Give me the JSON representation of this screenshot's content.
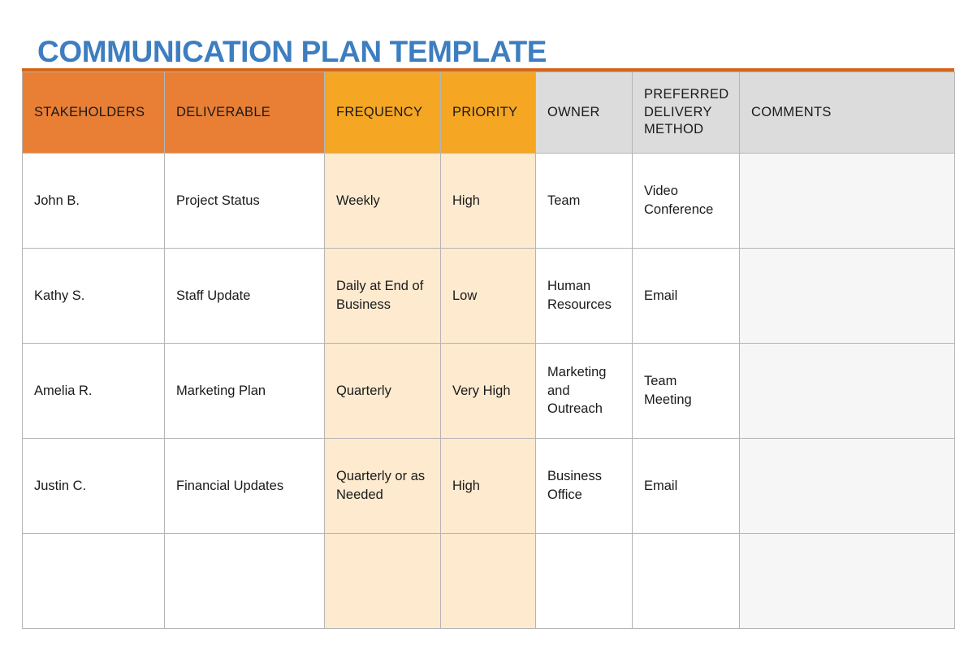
{
  "document": {
    "title": "COMMUNICATION PLAN TEMPLATE",
    "title_color": "#3d7ec0"
  },
  "theme": {
    "top_border": "#d4651a",
    "header_orange": "#e87f35",
    "header_amber": "#f5a623",
    "header_gray": "#dcdcdc",
    "cell_peach": "#fdeacf",
    "cell_gray": "#f6f6f6",
    "grid_line": "#b5b5b5",
    "text": "#1a1a1a"
  },
  "table": {
    "columns": [
      {
        "key": "stakeholders",
        "label": "STAKEHOLDERS",
        "header_style": "orange",
        "cell_style": "plain"
      },
      {
        "key": "deliverable",
        "label": "DELIVERABLE",
        "header_style": "orange",
        "cell_style": "plain"
      },
      {
        "key": "frequency",
        "label": "FREQUENCY",
        "header_style": "amber",
        "cell_style": "peach"
      },
      {
        "key": "priority",
        "label": "PRIORITY",
        "header_style": "amber",
        "cell_style": "peach"
      },
      {
        "key": "owner",
        "label": "OWNER",
        "header_style": "gray",
        "cell_style": "plain"
      },
      {
        "key": "delivery_method",
        "label": "PREFERRED DELIVERY METHOD",
        "header_style": "gray",
        "cell_style": "plain"
      },
      {
        "key": "comments",
        "label": "COMMENTS",
        "header_style": "gray",
        "cell_style": "gray"
      }
    ],
    "rows": [
      {
        "stakeholders": "John B.",
        "deliverable": "Project Status",
        "frequency": "Weekly",
        "priority": "High",
        "owner": "Team",
        "delivery_method": "Video Conference",
        "comments": ""
      },
      {
        "stakeholders": "Kathy S.",
        "deliverable": "Staff Update",
        "frequency": "Daily at End of Business",
        "priority": "Low",
        "owner": "Human Resources",
        "delivery_method": "Email",
        "comments": ""
      },
      {
        "stakeholders": "Amelia R.",
        "deliverable": "Marketing Plan",
        "frequency": "Quarterly",
        "priority": "Very High",
        "owner": "Marketing and Outreach",
        "delivery_method": "Team Meeting",
        "comments": ""
      },
      {
        "stakeholders": "Justin C.",
        "deliverable": "Financial Updates",
        "frequency": "Quarterly or as Needed",
        "priority": "High",
        "owner": "Business Office",
        "delivery_method": "Email",
        "comments": ""
      },
      {
        "stakeholders": "",
        "deliverable": "",
        "frequency": "",
        "priority": "",
        "owner": "",
        "delivery_method": "",
        "comments": ""
      }
    ]
  }
}
